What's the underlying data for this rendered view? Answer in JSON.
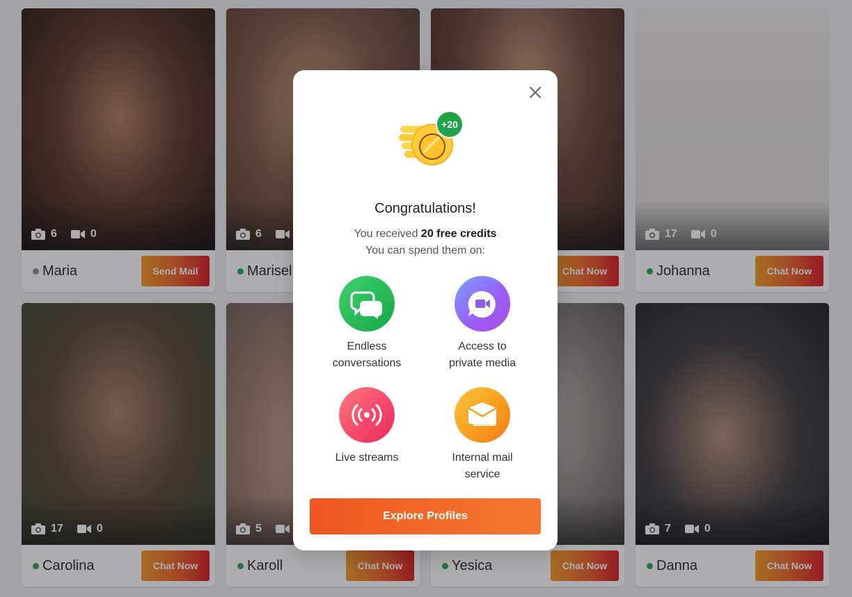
{
  "profiles": [
    {
      "name": "Maria",
      "photos": "6",
      "videos": "0",
      "online": false,
      "cta": "Send Mail"
    },
    {
      "name": "Marisel",
      "photos": "6",
      "videos": "",
      "online": true,
      "cta": ""
    },
    {
      "name": "",
      "photos": "",
      "videos": "",
      "online": true,
      "cta": "Chat Now"
    },
    {
      "name": "Johanna",
      "photos": "17",
      "videos": "0",
      "online": true,
      "cta": "Chat Now"
    },
    {
      "name": "Carolina",
      "photos": "17",
      "videos": "0",
      "online": true,
      "cta": "Chat Now"
    },
    {
      "name": "Karoll",
      "photos": "5",
      "videos": "",
      "online": true,
      "cta": "Chat Now"
    },
    {
      "name": "Yesica",
      "photos": "",
      "videos": "",
      "online": true,
      "cta": "Chat Now"
    },
    {
      "name": "Danna",
      "photos": "7",
      "videos": "0",
      "online": true,
      "cta": "Chat Now"
    }
  ],
  "modal": {
    "badge": "+20",
    "title": "Congratulations!",
    "received_prefix": "You received ",
    "received_bold": "20 free credits",
    "spend": "You can spend them on:",
    "features": [
      {
        "icon": "chat-bubbles-icon",
        "label_l1": "Endless",
        "label_l2": "conversations",
        "color": "#1fa34a"
      },
      {
        "icon": "video-camera-icon",
        "label_l1": "Access to",
        "label_l2": "private media",
        "color": "#9a5cf6"
      },
      {
        "icon": "broadcast-icon",
        "label_l1": "Live streams",
        "label_l2": "",
        "color": "#f5446a"
      },
      {
        "icon": "envelope-icon",
        "label_l1": "Internal mail",
        "label_l2": "service",
        "color": "#f79a1c"
      }
    ],
    "button": "Explore Profiles"
  },
  "colors": {
    "accent": "#ef5620",
    "online": "#1fa34a",
    "offline": "#8a8a8a"
  }
}
